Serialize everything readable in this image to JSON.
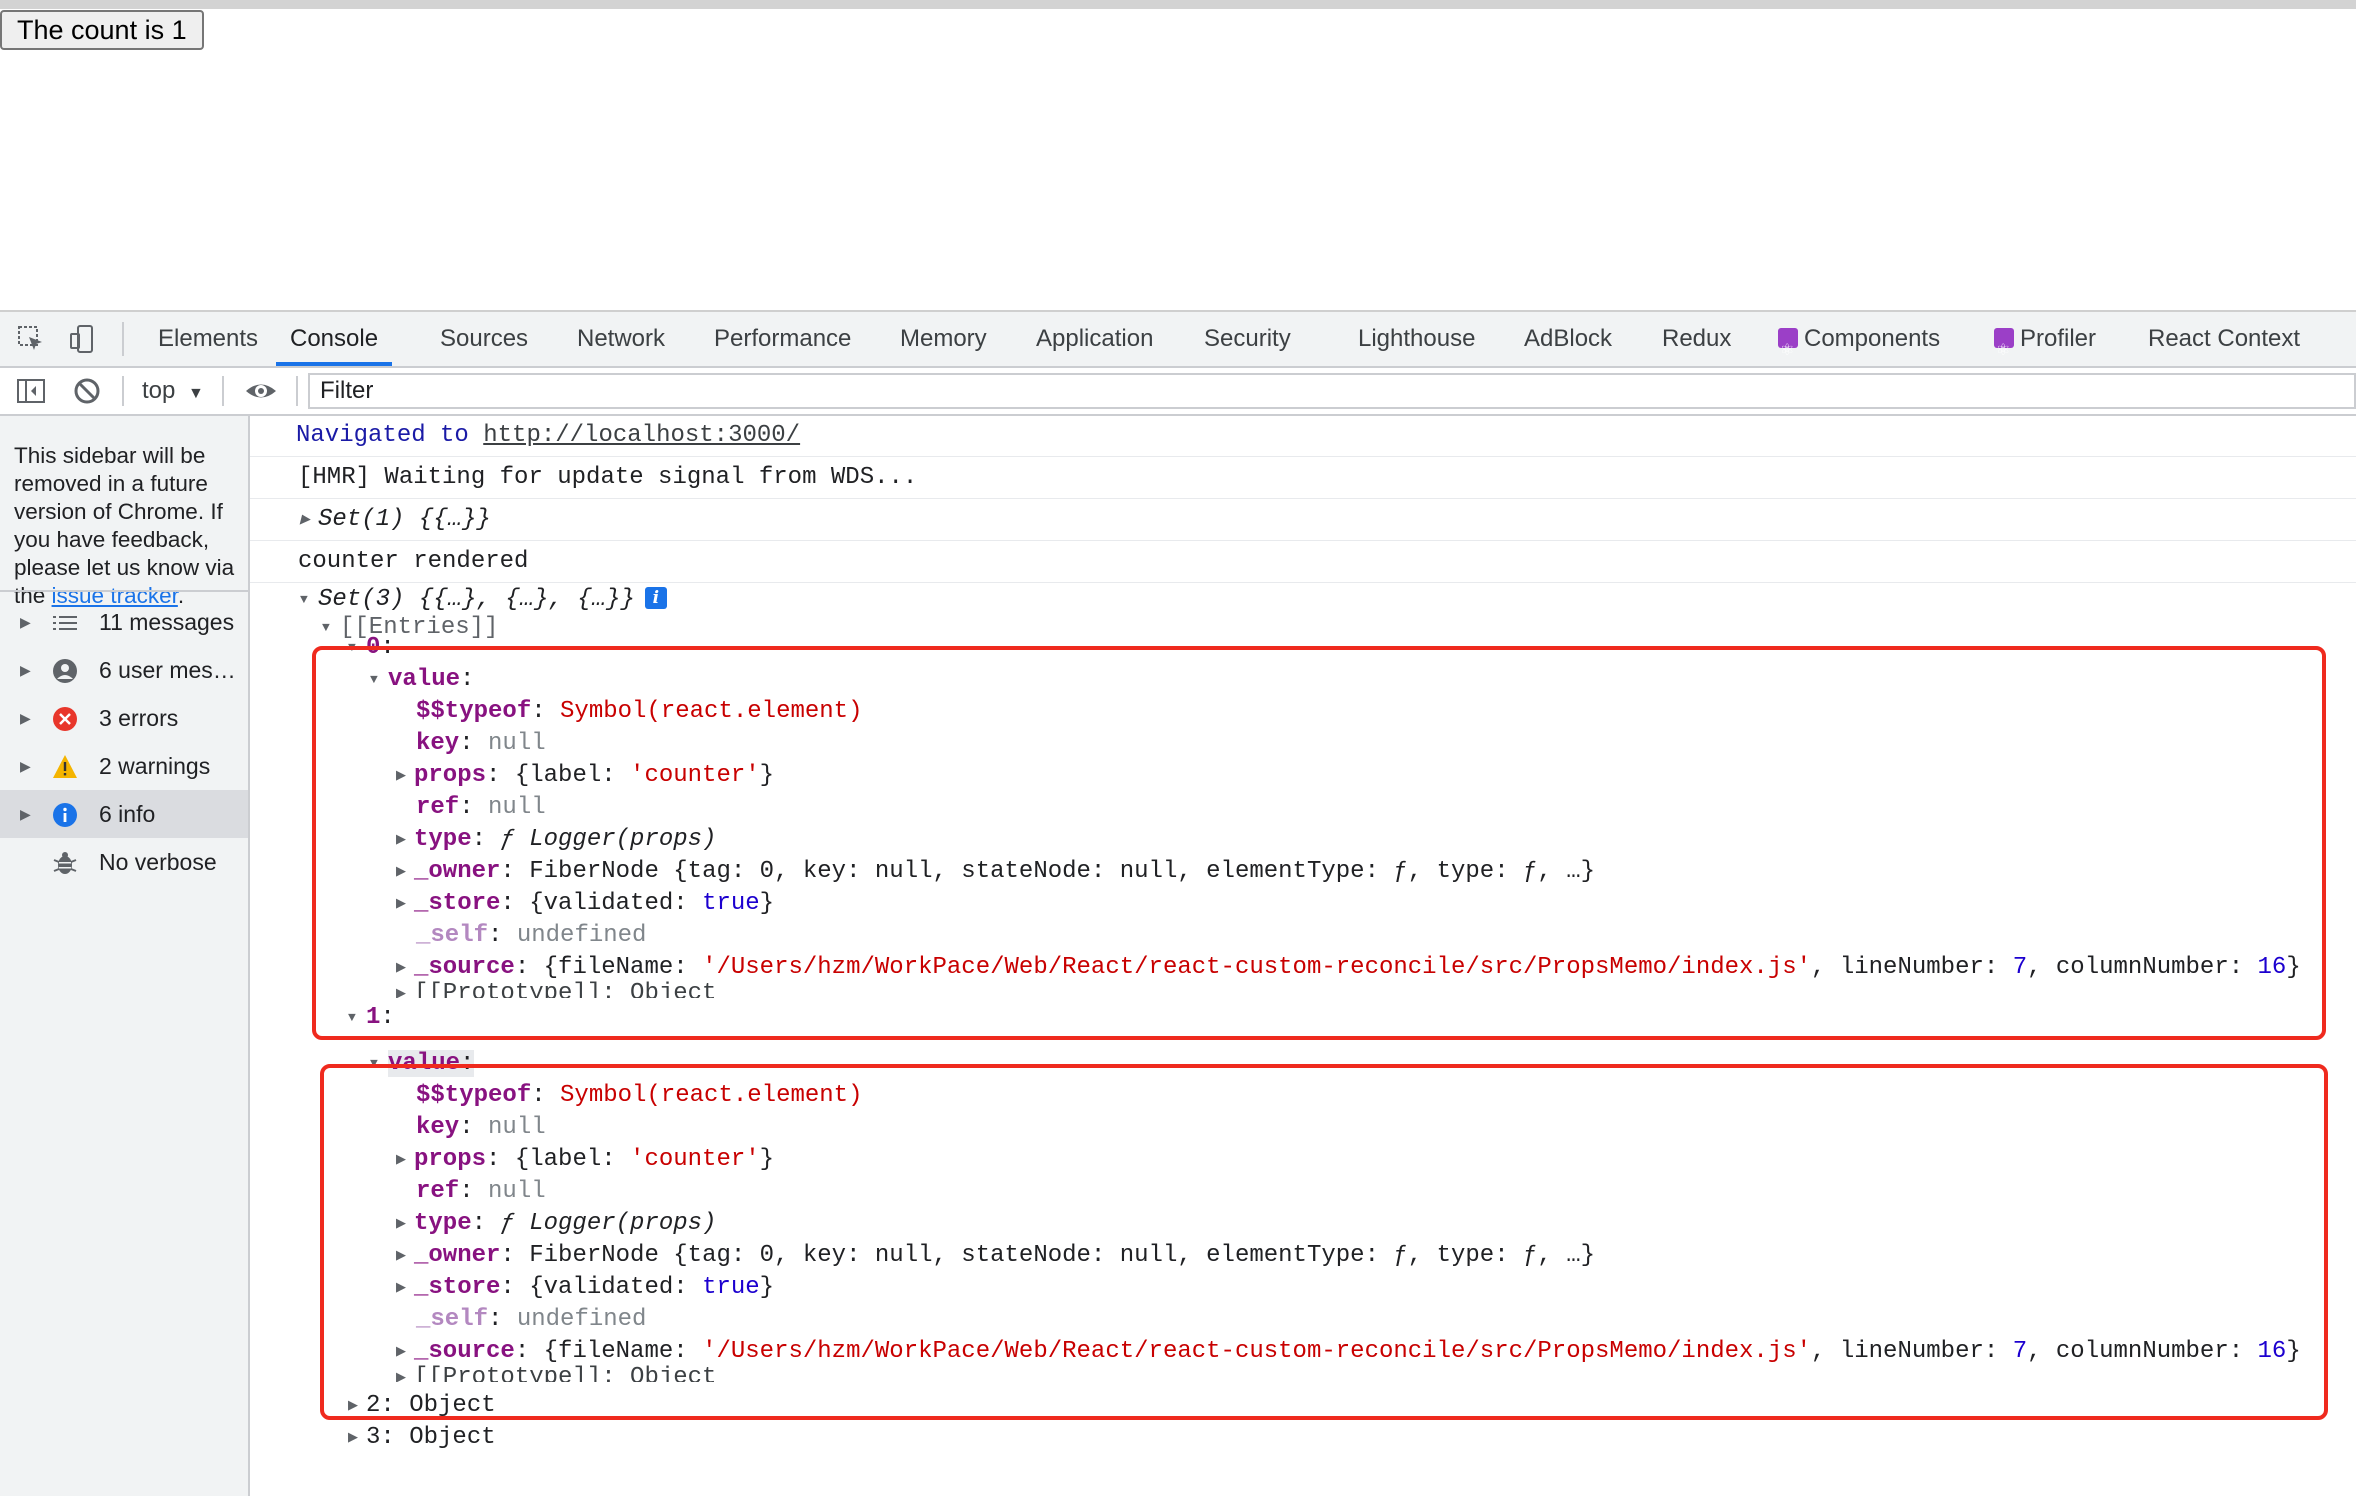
{
  "page": {
    "button_label": "The count is 1"
  },
  "devtools": {
    "tabs": [
      "Elements",
      "Console",
      "Sources",
      "Network",
      "Performance",
      "Memory",
      "Application",
      "Security",
      "Lighthouse",
      "AdBlock",
      "Redux",
      "Components",
      "Profiler",
      "React Context"
    ],
    "active_tab": "Console",
    "toolbar": {
      "context": "top",
      "filter_placeholder": "Filter"
    },
    "sidebar": {
      "notice_text": "This sidebar will be removed in a future version of Chrome. If you have feedback, please let us know via the",
      "notice_link": "issue tracker",
      "notice_end": ".",
      "items": [
        {
          "label": "11 messages",
          "icon": "list-icon"
        },
        {
          "label": "6 user mes…",
          "icon": "user-icon"
        },
        {
          "label": "3 errors",
          "icon": "error-icon"
        },
        {
          "label": "2 warnings",
          "icon": "warning-icon"
        },
        {
          "label": "6 info",
          "icon": "info-icon",
          "selected": true
        },
        {
          "label": "No verbose",
          "icon": "bug-icon"
        }
      ]
    },
    "console": {
      "navigated_prefix": "Navigated to ",
      "navigated_url": "http://localhost:3000/",
      "hmr": "[HMR] Waiting for update signal from WDS...",
      "set1": "Set(1) {{…}}",
      "counter_rendered": "counter rendered",
      "set3": "Set(3) {{…}, {…}, {…}}",
      "entries_label": "[[Entries]]",
      "entry_0": "0",
      "entry_1": "1",
      "entry_2": "2: Object",
      "entry_3": "3: Object",
      "value_key": "value",
      "typeof_key": "$$typeof",
      "typeof_val": "Symbol(react.element)",
      "key_key": "key",
      "null_val": "null",
      "props_key": "props",
      "props_label_key": "{label: ",
      "props_label_val": "'counter'",
      "ref_key": "ref",
      "type_key": "type",
      "type_val": "ƒ Logger(props)",
      "owner_key": "_owner",
      "owner_val": "FiberNode {tag: 0, key: null, stateNode: null, elementType: ƒ, type: ƒ, …}",
      "store_key": "_store",
      "store_pre": "{validated: ",
      "store_true": "true",
      "self_key": "_self",
      "self_val": "undefined",
      "source_key": "_source",
      "source_filename": "'/Users/hzm/WorkPace/Web/React/react-custom-reconcile/src/PropsMemo/index.js'",
      "source_line": "7",
      "source_col": "16",
      "prototype": "[[Prototype]]: Object"
    }
  },
  "colors": {
    "accent": "#1a73e8",
    "annotation": "#ef2a1e"
  }
}
